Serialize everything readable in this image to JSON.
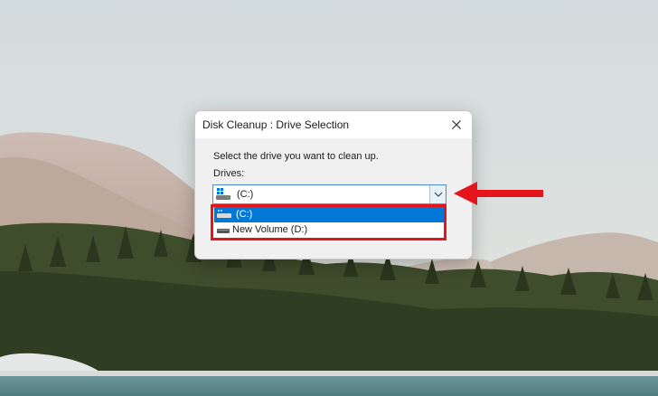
{
  "dialog": {
    "title": "Disk Cleanup : Drive Selection",
    "prompt": "Select the drive you want to clean up.",
    "drives_label": "Drives:",
    "selected_drive": "(C:)",
    "options": [
      {
        "label": "(C:)",
        "icon": "windows-drive-icon",
        "selected": true
      },
      {
        "label": "New Volume (D:)",
        "icon": "drive-icon",
        "selected": false
      }
    ]
  },
  "colors": {
    "selection": "#0078d7",
    "annotation_red": "#e4161c",
    "dialog_bg": "#f0f0f0"
  },
  "icons": [
    "close-icon",
    "chevron-down-icon",
    "windows-drive-icon",
    "drive-icon",
    "red-arrow-icon"
  ]
}
